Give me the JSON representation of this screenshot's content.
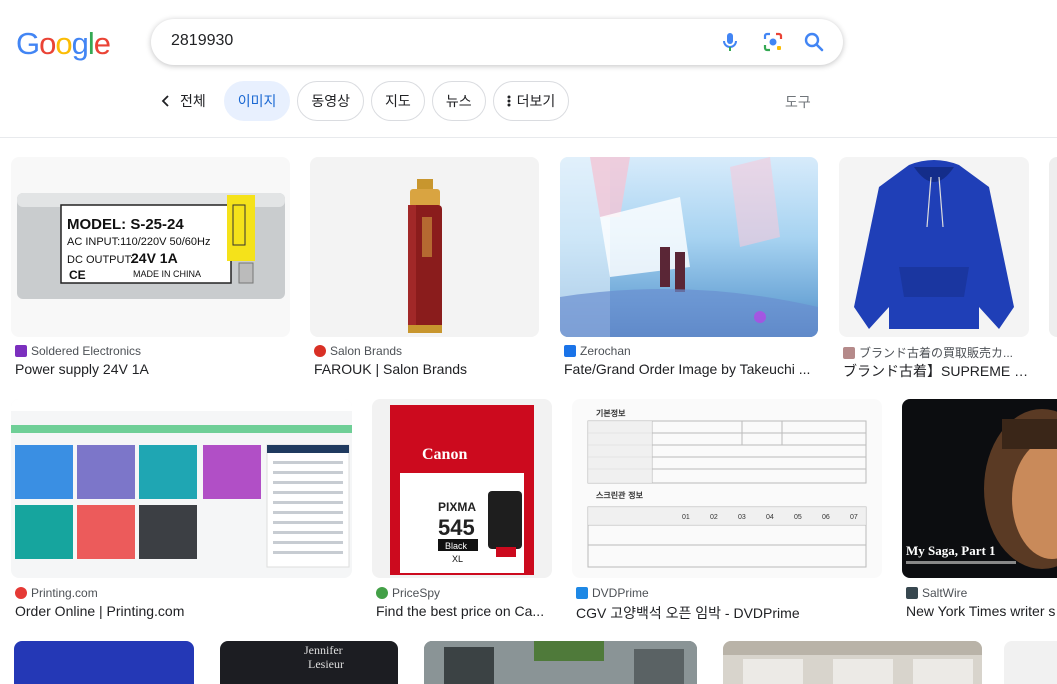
{
  "search": {
    "query": "2819930"
  },
  "logo": {
    "letters": [
      "G",
      "o",
      "o",
      "g",
      "l",
      "e"
    ],
    "colors": [
      "#4285F4",
      "#EA4335",
      "#FBBC05",
      "#4285F4",
      "#34A853",
      "#EA4335"
    ]
  },
  "icons": {
    "mic": "mic-icon",
    "lens": "camera-lens-icon",
    "search": "search-icon"
  },
  "tabs": {
    "all": "전체",
    "items": [
      {
        "label": "이미지",
        "active": true
      },
      {
        "label": "동영상",
        "active": false
      },
      {
        "label": "지도",
        "active": false
      },
      {
        "label": "뉴스",
        "active": false
      },
      {
        "label": "더보기",
        "active": false
      }
    ],
    "tools": "도구"
  },
  "results": [
    {
      "source": "Soldered Electronics",
      "title": "Power supply 24V 1A",
      "fav": "#7b2fbe"
    },
    {
      "source": "Salon Brands",
      "title": "FAROUK | Salon Brands",
      "fav": "#d93025"
    },
    {
      "source": "Zerochan",
      "title": "Fate/Grand Order Image by Takeuchi ...",
      "fav": "#1a73e8"
    },
    {
      "source": "ブランド古着の買取販売カ...",
      "title": "ブランド古着】SUPREME × ...",
      "fav": "#b58a8a"
    },
    {
      "source": "Printing.com",
      "title": "Order Online | Printing.com",
      "fav": "#e53935"
    },
    {
      "source": "PriceSpy",
      "title": "Find the best price on Ca...",
      "fav": "#43a047"
    },
    {
      "source": "DVDPrime",
      "title": "CGV 고양백석 오픈 임박 - DVDPrime",
      "fav": "#1e88e5"
    },
    {
      "source": "SaltWire",
      "title": "New York Times writer s",
      "fav": "#37474f"
    }
  ],
  "thumbs": {
    "psu": {
      "model": "MODEL: S-25-24",
      "input": "AC INPUT:110/220V  50/60Hz",
      "output_label": "DC OUTPUT:",
      "output_value": "24V 1A",
      "ce": "CE",
      "origin": "MADE IN CHINA"
    },
    "canon": {
      "brand": "Canon",
      "line": "PIXMA",
      "number": "545",
      "black": "Black",
      "xl": "XL"
    },
    "cgv": {
      "heading1": "기본정보",
      "heading2": "스크린관 정보",
      "screen_cols": [
        "01",
        "02",
        "03",
        "04",
        "05",
        "06",
        "07"
      ]
    },
    "saltwire": {
      "caption": "My Saga, Part 1"
    },
    "jennifer": {
      "line1": "Jennifer",
      "line2": "Lesieur"
    }
  }
}
